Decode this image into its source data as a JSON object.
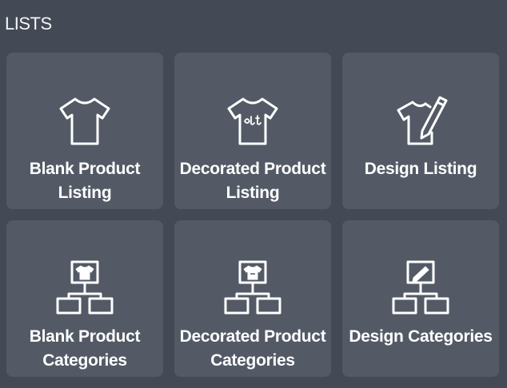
{
  "section": {
    "title": "LISTS"
  },
  "tiles": [
    {
      "label": "Blank Product\nListing",
      "icon": "tshirt-icon"
    },
    {
      "label": "Decorated Product\nListing",
      "icon": "decorated-tshirt-icon"
    },
    {
      "label": "Design Listing",
      "icon": "tshirt-pencil-icon"
    },
    {
      "label": "Blank Product\nCategories",
      "icon": "tshirt-hierarchy-icon"
    },
    {
      "label": "Decorated Product\nCategories",
      "icon": "decorated-tshirt-hierarchy-icon"
    },
    {
      "label": "Design Categories",
      "icon": "pencil-hierarchy-icon"
    }
  ],
  "colors": {
    "background": "#434a55",
    "tile": "#535a66",
    "text": "#ffffff"
  }
}
